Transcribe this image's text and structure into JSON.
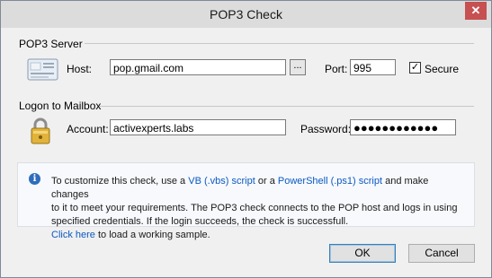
{
  "window": {
    "title": "POP3 Check",
    "close_glyph": "✕"
  },
  "pop3_server": {
    "group_title": "POP3 Server",
    "host_label": "Host:",
    "host_value": "pop.gmail.com",
    "browse_label": "...",
    "port_label": "Port:",
    "port_value": "995",
    "secure_label": "Secure",
    "secure_checked": true
  },
  "logon": {
    "group_title": "Logon to Mailbox",
    "account_label": "Account:",
    "account_value": "activexperts.labs",
    "password_label": "Password:",
    "password_mask": "●●●●●●●●●●●●"
  },
  "info": {
    "line1_a": "To customize this check, use a ",
    "vb_link": "VB (.vbs) script",
    "line1_b": " or a ",
    "ps_link": "PowerShell (.ps1) script",
    "line1_c": " and make changes",
    "line2": "to it to meet your requirements. The POP3 check connects to the POP host and logs in using",
    "line3": "specified credentials. If the login succeeds, the check is successfull.",
    "click_link": "Click here",
    "line4_b": " to load a working sample."
  },
  "buttons": {
    "ok": "OK",
    "cancel": "Cancel"
  },
  "icons": {
    "server": "mail-server-icon",
    "lock": "padlock-icon",
    "info": "info-icon",
    "close": "close-icon"
  },
  "colors": {
    "link": "#0b59c1",
    "close": "#c75050",
    "info": "#2e6dbb"
  }
}
